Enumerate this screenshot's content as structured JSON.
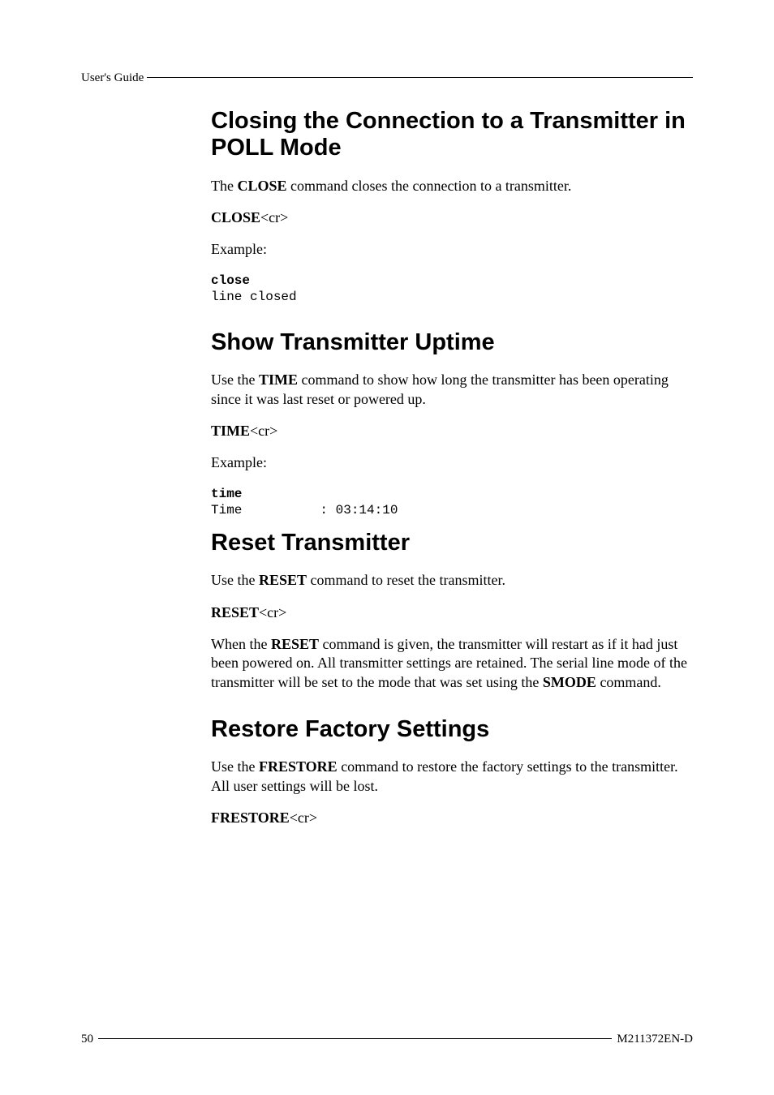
{
  "header": {
    "label": "User's Guide"
  },
  "sections": {
    "s1": {
      "title": "Closing the Connection to a Transmitter in POLL Mode",
      "p1_pre": "The ",
      "p1_cmd": "CLOSE",
      "p1_post": " command closes the connection to a transmitter.",
      "cmd_bold": "CLOSE",
      "cmd_tail": "<cr>",
      "example_label": "Example:",
      "terminal": {
        "line1": "close",
        "line2": "line closed"
      }
    },
    "s2": {
      "title": "Show Transmitter Uptime",
      "p1_pre": "Use the ",
      "p1_cmd": "TIME",
      "p1_post": " command to show how long the transmitter has been operating since it was last reset or powered up.",
      "cmd_bold": "TIME",
      "cmd_tail": "<cr>",
      "example_label": "Example:",
      "terminal": {
        "line1": "time",
        "line2": "Time          : 03:14:10"
      }
    },
    "s3": {
      "title": "Reset Transmitter",
      "p1_pre": "Use the ",
      "p1_cmd": "RESET",
      "p1_post": " command to reset the transmitter.",
      "cmd_bold": "RESET",
      "cmd_tail": "<cr>",
      "p2_pre": "When the ",
      "p2_cmd": "RESET",
      "p2_mid": " command is given, the transmitter will restart as if it had just been powered on. All transmitter settings are retained. The serial line mode of the transmitter will be set to the mode that was set using the ",
      "p2_cmd2": "SMODE",
      "p2_post": " command."
    },
    "s4": {
      "title": "Restore Factory Settings",
      "p1_pre": "Use the ",
      "p1_cmd": "FRESTORE",
      "p1_post": " command to restore the factory settings to the transmitter. All user settings will be lost.",
      "cmd_bold": "FRESTORE",
      "cmd_tail": "<cr>"
    }
  },
  "footer": {
    "page": "50",
    "docid": "M211372EN-D"
  }
}
